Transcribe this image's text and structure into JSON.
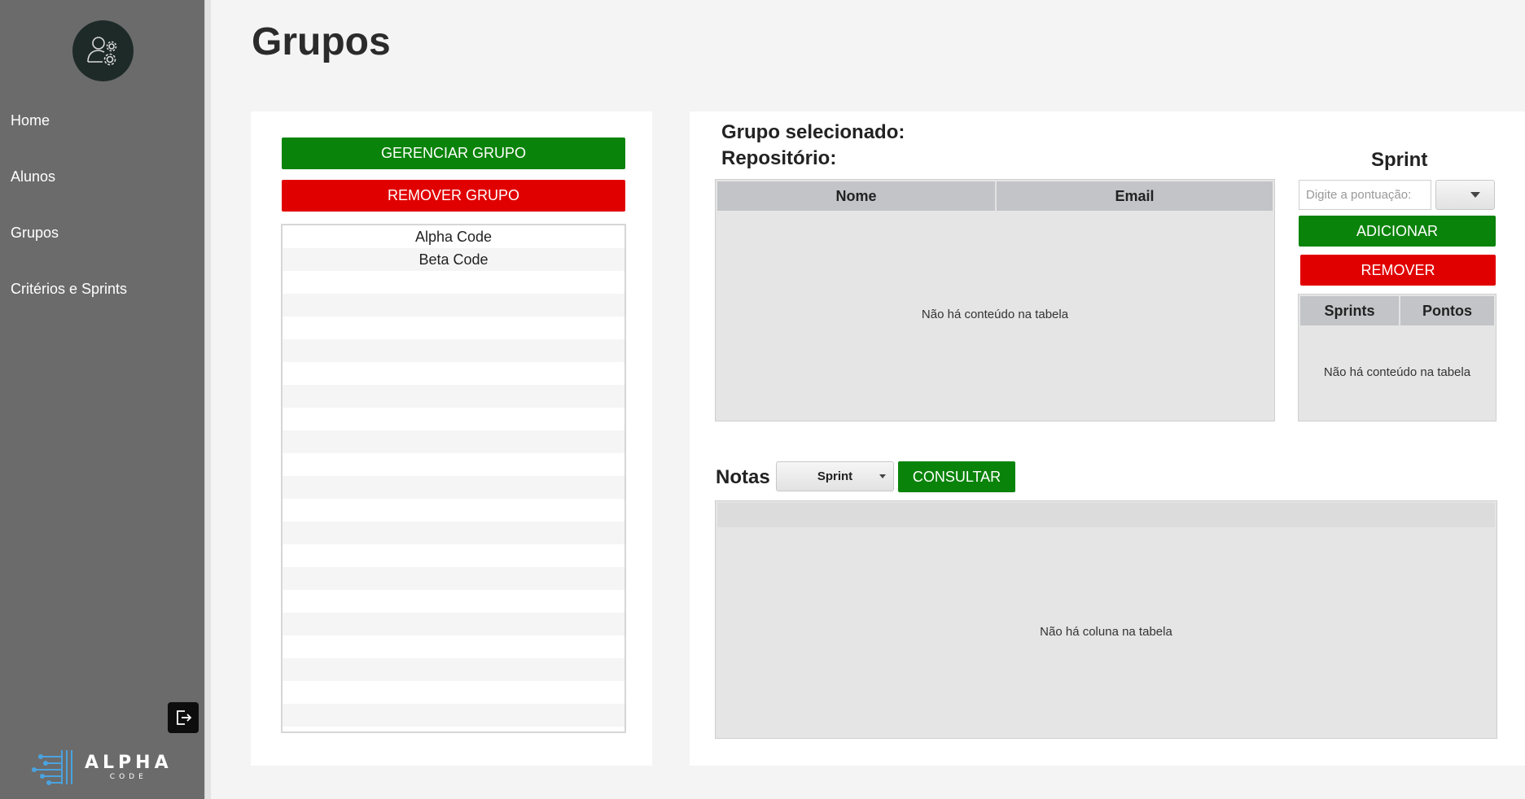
{
  "page": {
    "title": "Grupos"
  },
  "sidebar": {
    "items": [
      {
        "label": "Home"
      },
      {
        "label": "Alunos"
      },
      {
        "label": "Grupos"
      },
      {
        "label": "Critérios e Sprints"
      }
    ],
    "brand": {
      "name": "ALPHA",
      "sub": "CODE"
    }
  },
  "groups_panel": {
    "manage_label": "GERENCIAR GRUPO",
    "remove_label": "REMOVER GRUPO",
    "groups": [
      "Alpha Code",
      "Beta Code"
    ]
  },
  "details": {
    "selected_group_label": "Grupo selecionado:",
    "repository_label": "Repositório:",
    "members_table": {
      "columns": [
        "Nome",
        "Email"
      ],
      "empty_text": "Não há conteúdo na tabela"
    }
  },
  "sprint": {
    "title": "Sprint",
    "score_placeholder": "Digite a pontuação:",
    "add_label": "ADICIONAR",
    "remove_label": "REMOVER",
    "table": {
      "columns": [
        "Sprints",
        "Pontos"
      ],
      "empty_text": "Não há conteúdo na tabela"
    }
  },
  "grades": {
    "title": "Notas",
    "select_value": "Sprint",
    "consult_label": "CONSULTAR",
    "empty_text": "Não há coluna na tabela"
  },
  "colors": {
    "sidebar": "#6b6b6b",
    "green": "#0a830a",
    "red": "#e10000"
  }
}
